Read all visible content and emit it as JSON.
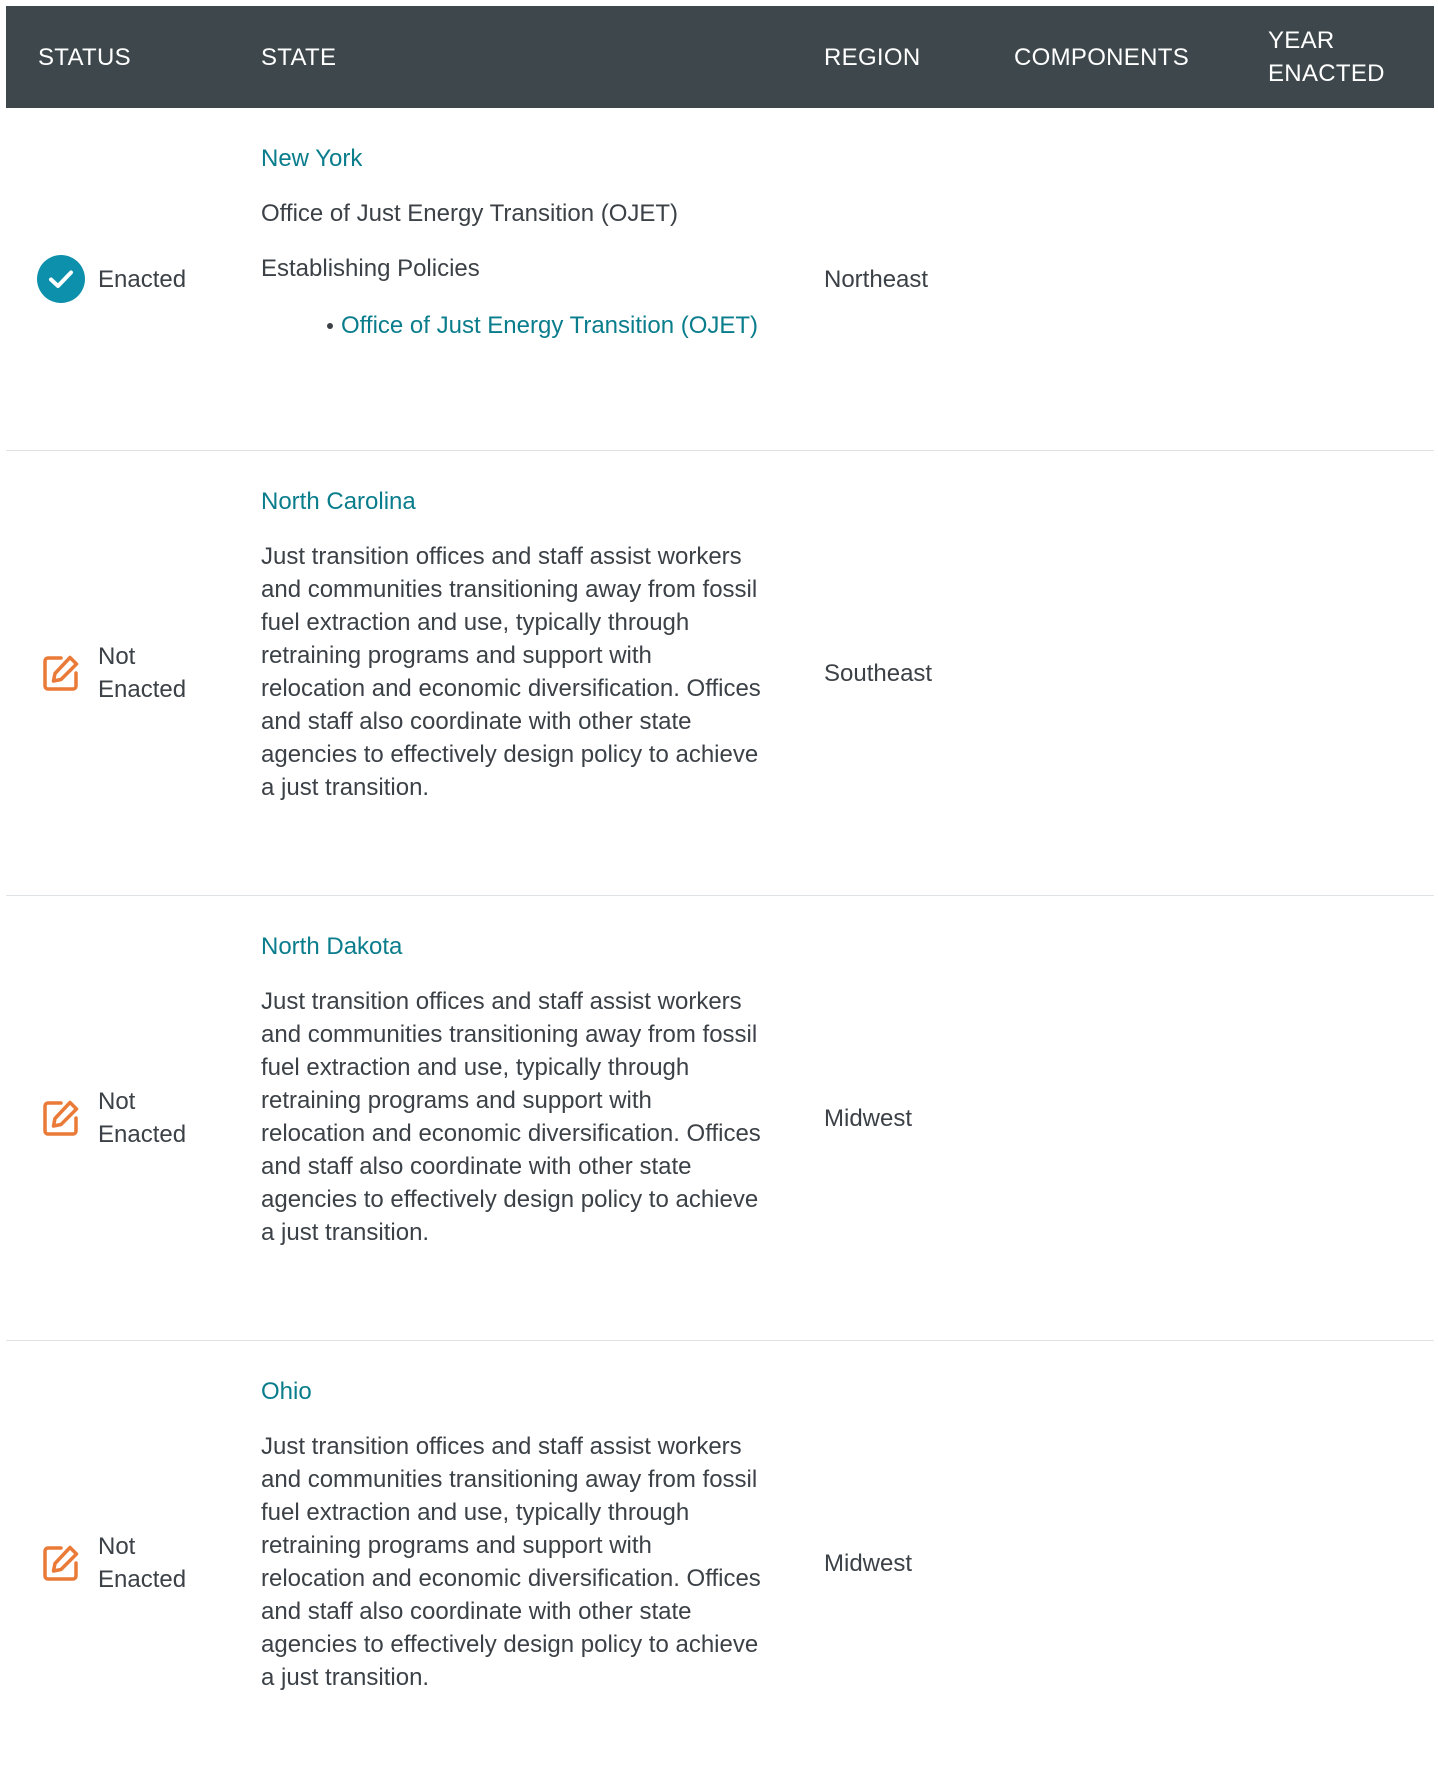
{
  "colors": {
    "header_bg": "#3e484c",
    "link": "#0a7d8c",
    "enacted_icon": "#0d90ab",
    "not_enacted_icon": "#ea7a37",
    "divider": "#dfe3e5"
  },
  "table": {
    "headers": {
      "status": "STATUS",
      "state": "STATE",
      "region": "REGION",
      "components": "COMPONENTS",
      "year_enacted": "YEAR ENACTED"
    },
    "rows": [
      {
        "status": "Enacted",
        "status_icon": "check-circle-icon",
        "state": "New York",
        "description": "Office of Just Energy Transition (OJET)",
        "section_label": "Establishing Policies",
        "policies": [
          "Office of Just Energy Transition (OJET)"
        ],
        "region": "Northeast"
      },
      {
        "status": "Not Enacted",
        "status_icon": "edit-pencil-icon",
        "state": "North Carolina",
        "description": "Just transition offices and staff assist workers and communities transitioning away from fossil fuel extraction and use, typically through retraining programs and support with relocation and economic diversification. Offices and staff also coordinate with other state agencies to effectively design policy to achieve a just transition.",
        "region": "Southeast"
      },
      {
        "status": "Not Enacted",
        "status_icon": "edit-pencil-icon",
        "state": "North Dakota",
        "description": "Just transition offices and staff assist workers and communities transitioning away from fossil fuel extraction and use, typically through retraining programs and support with relocation and economic diversification. Offices and staff also coordinate with other state agencies to effectively design policy to achieve a just transition.",
        "region": "Midwest"
      },
      {
        "status": "Not Enacted",
        "status_icon": "edit-pencil-icon",
        "state": "Ohio",
        "description": "Just transition offices and staff assist workers and communities transitioning away from fossil fuel extraction and use, typically through retraining programs and support with relocation and economic diversification. Offices and staff also coordinate with other state agencies to effectively design policy to achieve a just transition.",
        "region": "Midwest"
      }
    ]
  }
}
